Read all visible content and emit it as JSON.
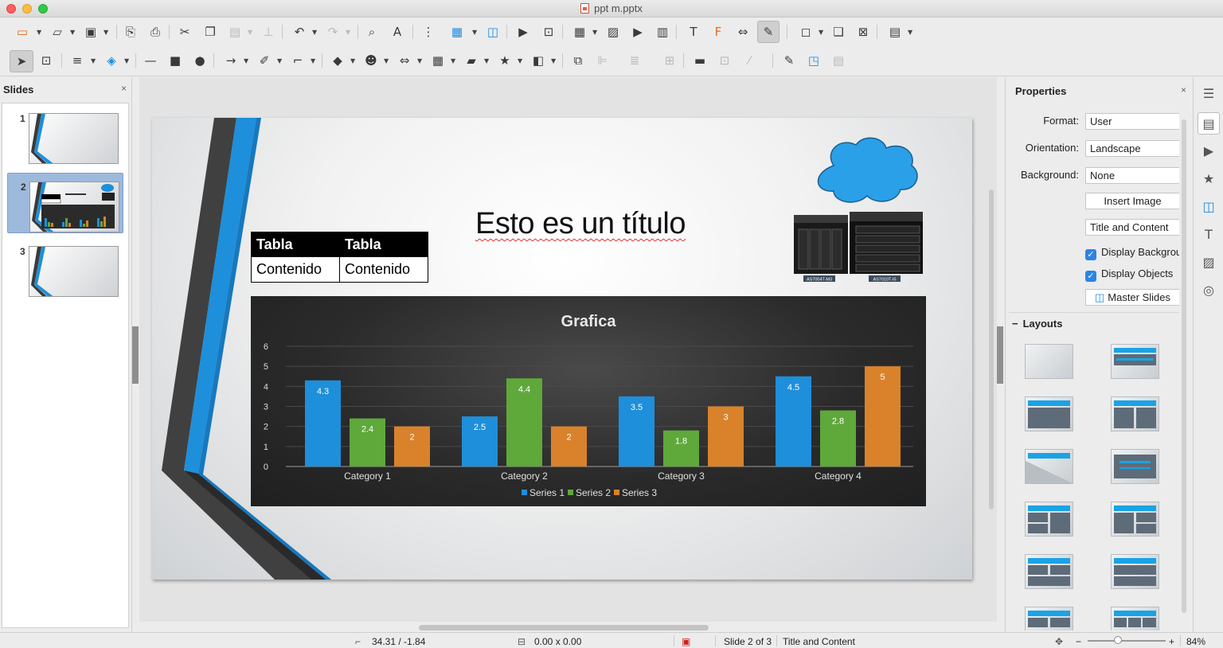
{
  "window": {
    "title": "ppt m.pptx"
  },
  "slides_panel": {
    "title": "Slides",
    "close": "×",
    "items": [
      {
        "number": "1"
      },
      {
        "number": "2",
        "selected": true
      },
      {
        "number": "3"
      }
    ]
  },
  "slide": {
    "title": "Esto es un título",
    "table": {
      "headers": [
        "Tabla",
        "Tabla"
      ],
      "cells": [
        "Contenido",
        "Contenido"
      ]
    },
    "server_labels": [
      "AS7004T-M3",
      "AS7010T-I5"
    ]
  },
  "chart_data": {
    "type": "bar",
    "title": "Grafica",
    "categories": [
      "Category 1",
      "Category 2",
      "Category 3",
      "Category 4"
    ],
    "series": [
      {
        "name": "Series 1",
        "values": [
          4.3,
          2.5,
          3.5,
          4.5
        ],
        "color": "#1e8fdb"
      },
      {
        "name": "Series 2",
        "values": [
          2.4,
          4.4,
          1.8,
          2.8
        ],
        "color": "#5fa83a"
      },
      {
        "name": "Series 3",
        "values": [
          2,
          2,
          3,
          5
        ],
        "color": "#d9822b"
      }
    ],
    "ylim": [
      0,
      6
    ],
    "yticks": [
      0,
      1,
      2,
      3,
      4,
      5,
      6
    ],
    "grid": true,
    "legend": "bottom"
  },
  "sidebar": {
    "title": "Properties",
    "close": "×",
    "format_label": "Format:",
    "format_value": "User",
    "orientation_label": "Orientation:",
    "orientation_value": "Landscape",
    "background_label": "Background:",
    "background_value": "None",
    "insert_image": "Insert Image",
    "layout_value": "Title and Content",
    "display_background": "Display Background",
    "display_objects": "Display Objects",
    "master_slides": "Master Slides",
    "layouts_title": "Layouts",
    "layouts_collapse": "−"
  },
  "statusbar": {
    "position": "34.31 / -1.84",
    "size": "0.00 x 0.00",
    "slide_info": "Slide 2 of 3",
    "layout": "Title and Content",
    "zoom_minus": "−",
    "zoom_plus": "+",
    "zoom": "84%"
  },
  "colors": {
    "accent_blue": "#1e8fdb",
    "chart_bg": "#2b2b2b",
    "selected_slide": "#9db9dc"
  }
}
